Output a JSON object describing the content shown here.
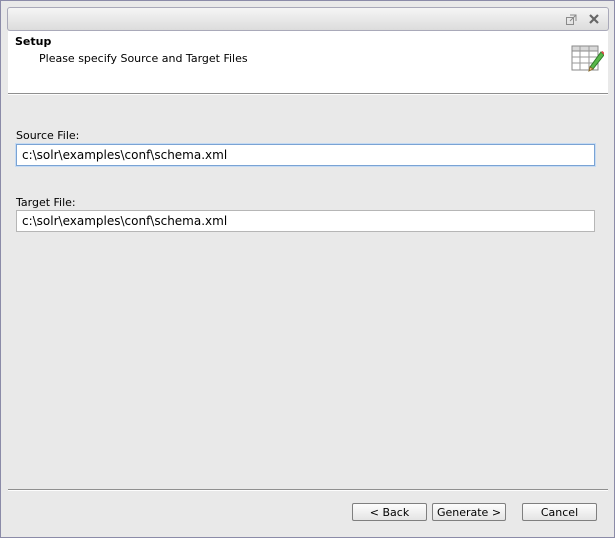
{
  "title_bar": {
    "restore_icon": "restore-window-icon",
    "close_icon": "close-icon"
  },
  "header": {
    "title": "Setup",
    "subtitle": "Please specify Source and Target Files",
    "icon": "table-edit-icon"
  },
  "form": {
    "source_label": "Source File:",
    "source_value": "c:\\solr\\examples\\conf\\schema.xml",
    "target_label": "Target File:",
    "target_value": "c:\\solr\\examples\\conf\\schema.xml"
  },
  "buttons": {
    "back": "< Back",
    "generate": "Generate >",
    "cancel": "Cancel"
  }
}
